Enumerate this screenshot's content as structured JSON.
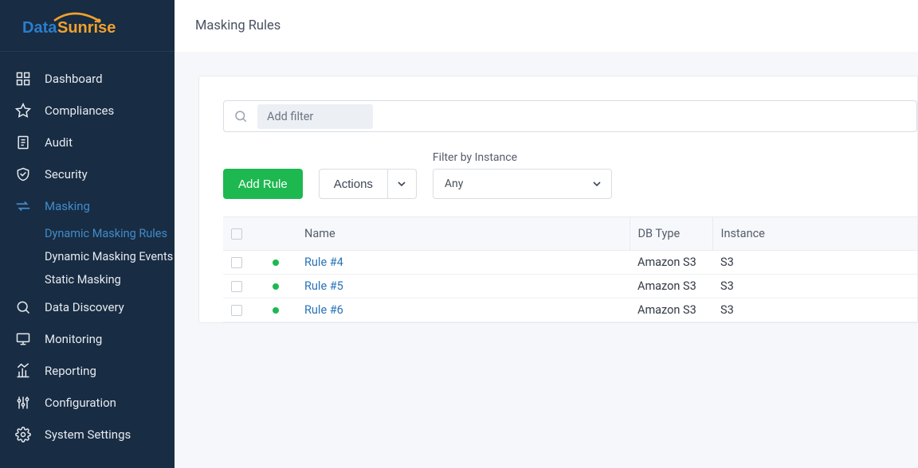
{
  "brand": {
    "word1": "Data",
    "word2": "Sunrise"
  },
  "page_title": "Masking Rules",
  "sidebar": {
    "items": [
      {
        "label": "Dashboard"
      },
      {
        "label": "Compliances"
      },
      {
        "label": "Audit"
      },
      {
        "label": "Security"
      },
      {
        "label": "Masking",
        "active": true,
        "children": [
          {
            "label": "Dynamic Masking Rules",
            "active": true
          },
          {
            "label": "Dynamic Masking Events"
          },
          {
            "label": "Static Masking"
          }
        ]
      },
      {
        "label": "Data Discovery"
      },
      {
        "label": "Monitoring"
      },
      {
        "label": "Reporting"
      },
      {
        "label": "Configuration"
      },
      {
        "label": "System Settings"
      }
    ]
  },
  "filter": {
    "placeholder": "Add filter"
  },
  "buttons": {
    "add_rule": "Add Rule",
    "actions": "Actions"
  },
  "instance_filter": {
    "label": "Filter by Instance",
    "value": "Any"
  },
  "table": {
    "columns": {
      "name": "Name",
      "db_type": "DB Type",
      "instance": "Instance"
    },
    "rows": [
      {
        "name": "Rule #4",
        "db_type": "Amazon S3",
        "instance": "S3"
      },
      {
        "name": "Rule #5",
        "db_type": "Amazon S3",
        "instance": "S3"
      },
      {
        "name": "Rule #6",
        "db_type": "Amazon S3",
        "instance": "S3"
      }
    ]
  }
}
